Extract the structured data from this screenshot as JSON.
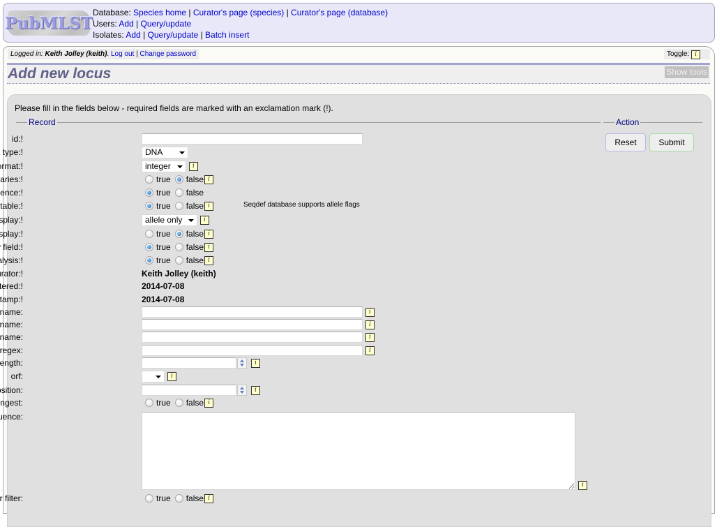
{
  "header": {
    "logo_text": "PubMLST",
    "rows": [
      {
        "label": "Database:",
        "links": [
          "Species home",
          "Curator's page (species)",
          "Curator's page (database)"
        ]
      },
      {
        "label": "Users:",
        "links": [
          "Add",
          "Query/update"
        ]
      },
      {
        "label": "Isolates:",
        "links": [
          "Add",
          "Query/update",
          "Batch insert"
        ]
      }
    ]
  },
  "login": {
    "prefix": "Logged in:",
    "user": "Keith Jolley (keith)",
    "logout": "Log out",
    "change_password": "Change password"
  },
  "toggle": {
    "label": "Toggle:",
    "icon": "info-icon"
  },
  "page_title": "Add new locus",
  "show_tools": "Show tools",
  "instructions": "Please fill in the fields below - required fields are marked with an exclamation mark (!).",
  "record_legend": "Record",
  "action_legend": "Action",
  "actions": {
    "reset": "Reset",
    "submit": "Submit"
  },
  "info_glyph": "i",
  "radio_labels": {
    "true": "true",
    "false": "false"
  },
  "fields": {
    "id": {
      "label": "id:!",
      "value": ""
    },
    "data_type": {
      "label": "data type:!",
      "value": "DNA"
    },
    "allele_id_format": {
      "label": "allele id format:!",
      "value": "integer"
    },
    "length_varies": {
      "label": "length varies:!",
      "value": "false"
    },
    "coding_sequence": {
      "label": "coding sequence:!",
      "value": "true"
    },
    "flag_table": {
      "label": "flag table:!",
      "value": "true",
      "note": "Seqdef database supports allele flags"
    },
    "isolate_display": {
      "label": "isolate display:!",
      "value": "allele only"
    },
    "main_display": {
      "label": "main display:!",
      "value": "false"
    },
    "query_field": {
      "label": "query field:!",
      "value": "true"
    },
    "analysis": {
      "label": "analysis:!",
      "value": "true"
    },
    "curator": {
      "label": "curator:!",
      "value": "Keith Jolley (keith)"
    },
    "date_entered": {
      "label": "date entered:!",
      "value": "2014-07-08"
    },
    "datestamp": {
      "label": "datestamp:!",
      "value": "2014-07-08"
    },
    "formatted_name": {
      "label": "formatted name:",
      "value": ""
    },
    "common_name": {
      "label": "common name:",
      "value": ""
    },
    "formatted_common_name": {
      "label": "formatted common name:",
      "value": ""
    },
    "allele_id_regex": {
      "label": "allele id regex:",
      "value": ""
    },
    "length": {
      "label": "length:",
      "value": ""
    },
    "orf": {
      "label": "orf:",
      "value": ""
    },
    "genome_position": {
      "label": "genome position:",
      "value": ""
    },
    "match_longest": {
      "label": "match longest:",
      "value": ""
    },
    "reference_sequence": {
      "label": "reference sequence:",
      "value": ""
    },
    "pcr_filter": {
      "label": "pcr filter:",
      "value": ""
    }
  }
}
